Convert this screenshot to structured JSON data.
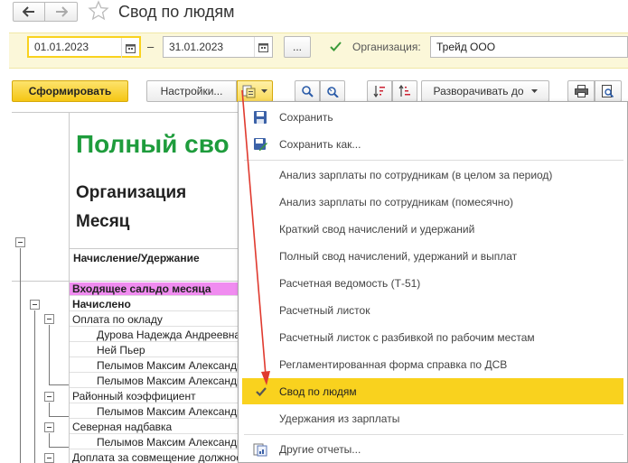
{
  "header": {
    "title": "Свод по людям",
    "back_icon": "arrow-left-icon",
    "forward_icon": "arrow-right-icon",
    "favorite_icon": "star-icon"
  },
  "filters": {
    "date_from": "01.01.2023",
    "date_separator": "–",
    "date_to": "31.01.2023",
    "more_label": "...",
    "org_checked": true,
    "org_label": "Организация:",
    "org_value": "Трейд ООО"
  },
  "toolbar": {
    "generate_label": "Сформировать",
    "settings_label": "Настройки...",
    "expand_label": "Разворачивать до"
  },
  "report": {
    "title": "Полный сво",
    "header_line1": "Организация",
    "header_line2": "Месяц",
    "column_header": "Начисление/Удержание",
    "rows": [
      {
        "text": "Входящее сальдо месяца",
        "indent": 0,
        "style": "highlight"
      },
      {
        "text": "Начислено",
        "indent": 0,
        "style": "bold"
      },
      {
        "text": "Оплата по окладу",
        "indent": 0,
        "style": "normal"
      },
      {
        "text": "Дурова Надежда Андреевна",
        "indent": 1,
        "style": "normal"
      },
      {
        "text": "Ней Пьер",
        "indent": 1,
        "style": "normal"
      },
      {
        "text": "Пелымов Максим Александрович",
        "indent": 1,
        "style": "normal"
      },
      {
        "text": "Пелымов Максим Александрович",
        "indent": 1,
        "style": "normal"
      },
      {
        "text": "Районный коэффициент",
        "indent": 0,
        "style": "normal"
      },
      {
        "text": "Пелымов Максим Александрович",
        "indent": 1,
        "style": "normal"
      },
      {
        "text": "Северная надбавка",
        "indent": 0,
        "style": "normal"
      },
      {
        "text": "Пелымов Максим Александрович",
        "indent": 1,
        "style": "normal"
      },
      {
        "text": "Доплата за совмещение должностей",
        "indent": 0,
        "style": "normal"
      }
    ]
  },
  "menu": {
    "items": [
      {
        "label": "Сохранить",
        "icon": "save-icon"
      },
      {
        "label": "Сохранить как...",
        "icon": "save-as-icon"
      },
      {
        "label": "Анализ зарплаты по сотрудникам (в целом за период)"
      },
      {
        "label": "Анализ зарплаты по сотрудникам (помесячно)"
      },
      {
        "label": "Краткий свод начислений и удержаний"
      },
      {
        "label": "Полный свод начислений, удержаний и выплат"
      },
      {
        "label": "Расчетная ведомость (Т-51)"
      },
      {
        "label": "Расчетный листок"
      },
      {
        "label": "Расчетный листок с разбивкой по рабочим местам"
      },
      {
        "label": "Регламентированная форма справка по ДСВ"
      },
      {
        "label": "Свод по людям",
        "checked": true,
        "selected": true
      },
      {
        "label": "Удержания из зарплаты"
      },
      {
        "label": "Другие отчеты...",
        "icon": "other-reports-icon"
      }
    ]
  },
  "colors": {
    "accent_yellow": "#f9d21e",
    "title_green": "#1e9c3c",
    "highlight_pink": "#f08cf0",
    "arrow_red": "#e03a2f",
    "checkbox_green": "#3a9a3a"
  }
}
